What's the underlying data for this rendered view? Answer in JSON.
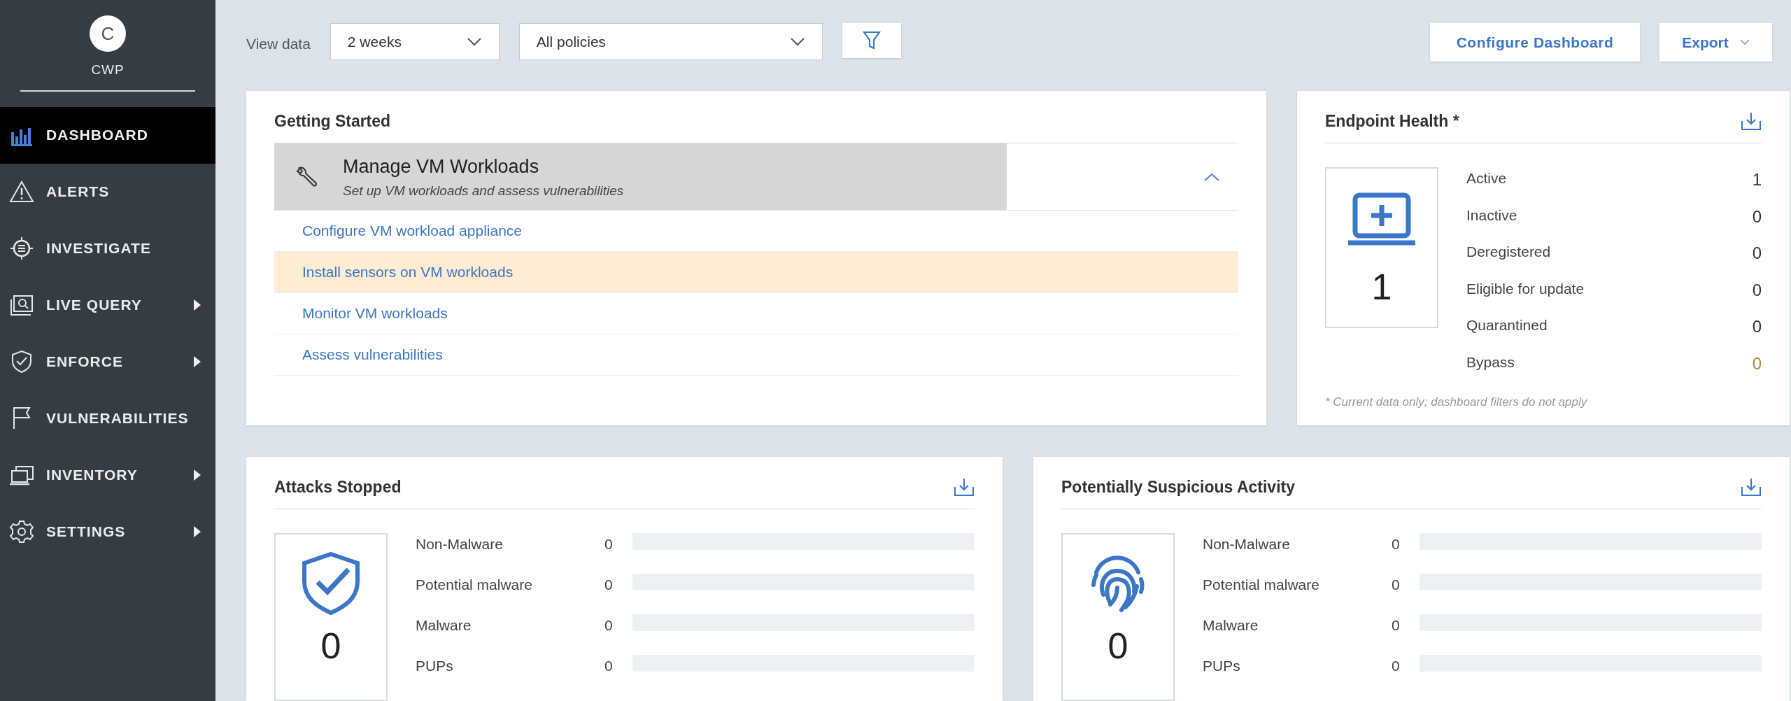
{
  "sidebar": {
    "avatar": "C",
    "org": "CWP",
    "items": [
      {
        "label": "DASHBOARD",
        "selected": true,
        "has_submenu": false
      },
      {
        "label": "ALERTS",
        "selected": false,
        "has_submenu": false
      },
      {
        "label": "INVESTIGATE",
        "selected": false,
        "has_submenu": false
      },
      {
        "label": "LIVE QUERY",
        "selected": false,
        "has_submenu": true
      },
      {
        "label": "ENFORCE",
        "selected": false,
        "has_submenu": true
      },
      {
        "label": "VULNERABILITIES",
        "selected": false,
        "has_submenu": false
      },
      {
        "label": "INVENTORY",
        "selected": false,
        "has_submenu": true
      },
      {
        "label": "SETTINGS",
        "selected": false,
        "has_submenu": true
      }
    ]
  },
  "toolbar": {
    "view_label": "View data",
    "period": "2 weeks",
    "policy": "All policies",
    "configure_button": "Configure Dashboard",
    "export_button": "Export"
  },
  "getting_started": {
    "title": "Getting Started",
    "section": {
      "title": "Manage VM Workloads",
      "subtitle": "Set up VM workloads and assess vulnerabilities",
      "expanded": true,
      "links": [
        {
          "label": "Configure VM workload appliance",
          "highlighted": false
        },
        {
          "label": "Install sensors on VM workloads",
          "highlighted": true
        },
        {
          "label": "Monitor VM workloads",
          "highlighted": false
        },
        {
          "label": "Assess vulnerabilities",
          "highlighted": false
        }
      ]
    }
  },
  "endpoint_health": {
    "title": "Endpoint Health *",
    "total": "1",
    "rows": [
      {
        "label": "Active",
        "value": "1",
        "color": "#333333"
      },
      {
        "label": "Inactive",
        "value": "0",
        "color": "#333333"
      },
      {
        "label": "Deregistered",
        "value": "0",
        "color": "#333333"
      },
      {
        "label": "Eligible for update",
        "value": "0",
        "color": "#333333"
      },
      {
        "label": "Quarantined",
        "value": "0",
        "color": "#333333"
      },
      {
        "label": "Bypass",
        "value": "0",
        "color": "#b8862e"
      }
    ],
    "footnote": "* Current data only; dashboard filters do not apply"
  },
  "summary_cards": [
    {
      "title": "Attacks Stopped",
      "total": "0",
      "rows": [
        {
          "label": "Non-Malware",
          "value": "0",
          "level": 0
        },
        {
          "label": "Potential malware",
          "value": "0",
          "level": 0
        },
        {
          "label": "Malware",
          "value": "0",
          "level": 0
        },
        {
          "label": "PUPs",
          "value": "0",
          "level": 0
        }
      ]
    },
    {
      "title": "Potentially Suspicious Activity",
      "total": "0",
      "rows": [
        {
          "label": "Non-Malware",
          "value": "0",
          "level": 0
        },
        {
          "label": "Potential malware",
          "value": "0",
          "level": 0
        },
        {
          "label": "Malware",
          "value": "0",
          "level": 0
        },
        {
          "label": "PUPs",
          "value": "0",
          "level": 0
        }
      ]
    }
  ]
}
